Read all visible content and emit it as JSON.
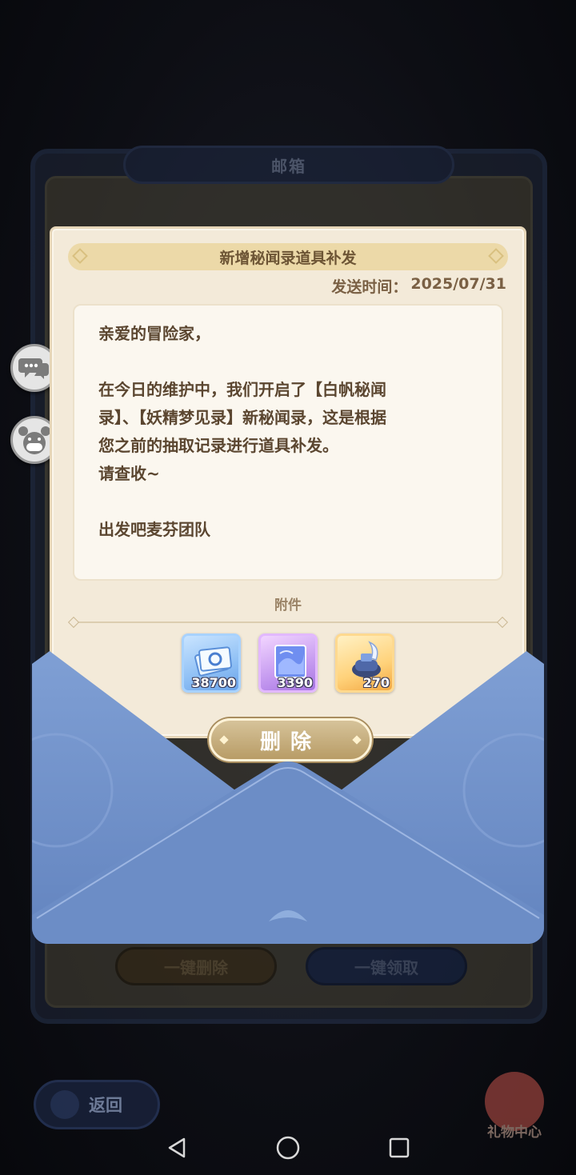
{
  "mailbox": {
    "title": "邮箱",
    "delete_all_label": "一键删除",
    "claim_all_label": "一键领取"
  },
  "letter": {
    "subject": "新增秘闻录道具补发",
    "date_label": "发送时间：",
    "date_value": "2025/07/31",
    "greeting": "亲爱的冒险家，",
    "body": "在今日的维护中，我们开启了【白帆秘闻\n录】、【妖精梦见录】新秘闻录，这是根据\n您之前的抽取记录进行道具补发。\n请查收~",
    "signature": "出发吧麦芬团队",
    "attachments_title": "附件",
    "attachments": [
      {
        "icon": "ticket-stack-icon",
        "qty": "38700",
        "color": "blue"
      },
      {
        "icon": "card-pack-icon",
        "qty": "3390",
        "color": "purple"
      },
      {
        "icon": "ink-bottle-icon",
        "qty": "270",
        "color": "orange"
      }
    ],
    "delete_label": "删除"
  },
  "back": {
    "label": "返回"
  },
  "gift_center": {
    "label": "礼物中心"
  },
  "colors": {
    "envelope": "#7394c8",
    "letter_bg": "#f3ead9",
    "header_band": "#ecd9a8",
    "delete_button": "#c5ad7c"
  }
}
